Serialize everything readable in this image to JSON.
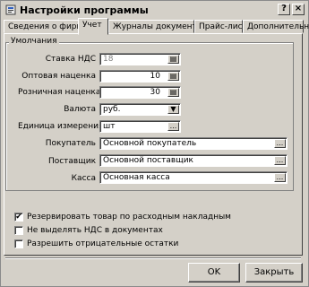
{
  "window": {
    "title": "Настройки программы"
  },
  "tabs": [
    {
      "label": "Сведения о фирме"
    },
    {
      "label": "Учет"
    },
    {
      "label": "Журналы документов"
    },
    {
      "label": "Прайс-лист"
    },
    {
      "label": "Дополнительно"
    }
  ],
  "defaults_group": {
    "label": "Умолчания",
    "vat_rate": {
      "label": "Ставка НДС",
      "value": "18"
    },
    "wholesale_markup": {
      "label": "Оптовая наценка",
      "value": "10"
    },
    "retail_markup": {
      "label": "Розничная наценка",
      "value": "30"
    },
    "currency": {
      "label": "Валюта",
      "value": "руб."
    },
    "unit": {
      "label": "Единица измерения",
      "value": "шт"
    },
    "buyer": {
      "label": "Покупатель",
      "value": "Основной покупатель"
    },
    "supplier": {
      "label": "Поставщик",
      "value": "Основной поставщик"
    },
    "cashbox": {
      "label": "Касса",
      "value": "Основная касса"
    }
  },
  "options": [
    {
      "label": "Резервировать товар по расходным накладным",
      "checked": true
    },
    {
      "label": "Не выделять НДС в документах",
      "checked": false
    },
    {
      "label": "Разрешить отрицательные остатки",
      "checked": false
    }
  ],
  "buttons": {
    "ok": "OK",
    "close": "Закрыть"
  },
  "glyphs": {
    "ellipsis": "...",
    "check": "✔",
    "dropdown": "▼",
    "calc": "▤",
    "close": "×",
    "help": "?"
  }
}
